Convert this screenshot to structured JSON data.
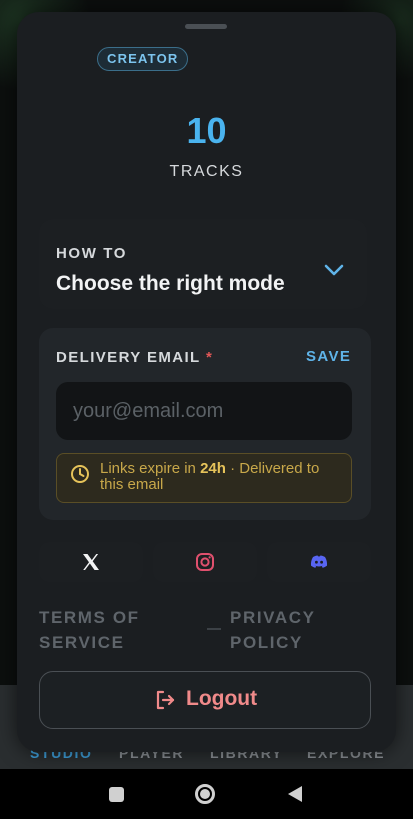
{
  "background_tabs": {
    "items": [
      {
        "label": "STUDIO",
        "active": true
      },
      {
        "label": "PLAYER",
        "active": false
      },
      {
        "label": "LIBRARY",
        "active": false
      },
      {
        "label": "EXPLORE",
        "active": false
      }
    ]
  },
  "sheet": {
    "badge": "CREATOR",
    "count": "10",
    "count_label": "TRACKS",
    "howto": {
      "kicker": "HOW TO",
      "title": "Choose the right mode",
      "icon": "chevron-down-icon"
    },
    "delivery": {
      "label": "DELIVERY EMAIL",
      "required_mark": "*",
      "save_label": "SAVE",
      "email_placeholder": "your@email.com",
      "email_value": "",
      "notice_prefix": "Links expire in ",
      "notice_bold": "24h",
      "notice_suffix": " · Delivered to this email"
    },
    "social": [
      {
        "name": "x-icon"
      },
      {
        "name": "instagram-icon"
      },
      {
        "name": "discord-icon"
      }
    ],
    "links": {
      "terms_line1": "TERMS OF",
      "terms_line2": "SERVICE",
      "privacy_line1": "PRIVACY",
      "privacy_line2": "POLICY"
    },
    "logout_label": "Logout"
  },
  "colors": {
    "accent_blue": "#4ab3ee",
    "danger": "#f08a8a",
    "warning": "#c8a84a",
    "instagram": "#e0506e",
    "discord": "#5865f2"
  }
}
